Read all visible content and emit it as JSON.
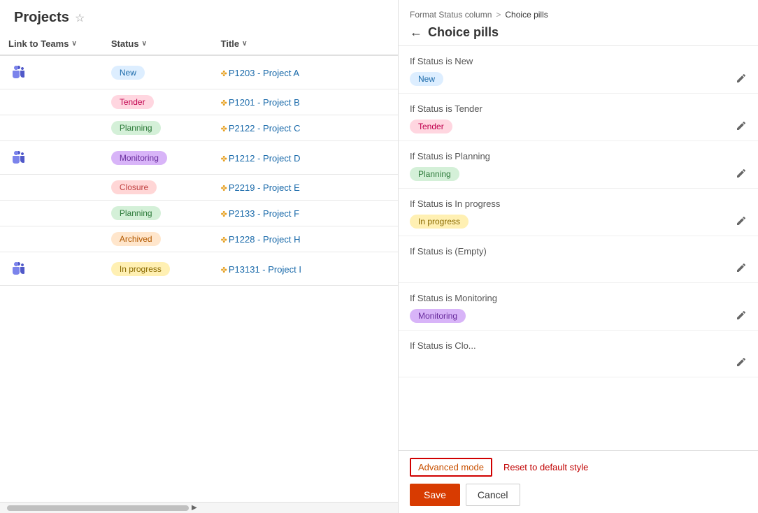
{
  "page": {
    "title": "Projects",
    "star_icon": "☆"
  },
  "table": {
    "columns": [
      {
        "id": "teams",
        "label": "Link to Teams",
        "has_dropdown": true
      },
      {
        "id": "status",
        "label": "Status",
        "has_dropdown": true
      },
      {
        "id": "title",
        "label": "Title",
        "has_dropdown": true
      }
    ],
    "rows": [
      {
        "teams": true,
        "status": "New",
        "status_class": "pill-new",
        "title": "P1203 - Project A"
      },
      {
        "teams": false,
        "status": "Tender",
        "status_class": "pill-tender",
        "title": "P1201 - Project B"
      },
      {
        "teams": false,
        "status": "Planning",
        "status_class": "pill-planning",
        "title": "P2122 - Project C"
      },
      {
        "teams": true,
        "status": "Monitoring",
        "status_class": "pill-monitoring",
        "title": "P1212 - Project D"
      },
      {
        "teams": false,
        "status": "Closure",
        "status_class": "pill-closure",
        "title": "P2219 - Project E"
      },
      {
        "teams": false,
        "status": "Planning",
        "status_class": "pill-planning",
        "title": "P2133 - Project F"
      },
      {
        "teams": false,
        "status": "Archived",
        "status_class": "pill-archived",
        "title": "P1228 - Project H"
      },
      {
        "teams": true,
        "status": "In progress",
        "status_class": "pill-inprogress",
        "title": "P13131 - Project I"
      }
    ]
  },
  "right_panel": {
    "breadcrumb_parent": "Format Status column",
    "breadcrumb_separator": ">",
    "breadcrumb_current": "Choice pills",
    "title": "Choice pills",
    "sections": [
      {
        "id": "new",
        "label": "If Status is New",
        "pill_text": "New",
        "pill_class": "pill-new"
      },
      {
        "id": "tender",
        "label": "If Status is Tender",
        "pill_text": "Tender",
        "pill_class": "pill-tender"
      },
      {
        "id": "planning",
        "label": "If Status is Planning",
        "pill_text": "Planning",
        "pill_class": "pill-planning"
      },
      {
        "id": "inprogress",
        "label": "If Status is In progress",
        "pill_text": "In progress",
        "pill_class": "pill-inprogress"
      },
      {
        "id": "empty",
        "label": "If Status is (Empty)",
        "pill_text": "",
        "pill_class": ""
      },
      {
        "id": "monitoring",
        "label": "If Status is Monitoring",
        "pill_text": "Monitoring",
        "pill_class": "pill-monitoring"
      },
      {
        "id": "closure",
        "label": "If Status is Clo...",
        "pill_text": "",
        "pill_class": ""
      }
    ],
    "footer": {
      "advanced_mode_label": "Advanced mode",
      "reset_label": "Reset to default style",
      "save_label": "Save",
      "cancel_label": "Cancel"
    }
  }
}
